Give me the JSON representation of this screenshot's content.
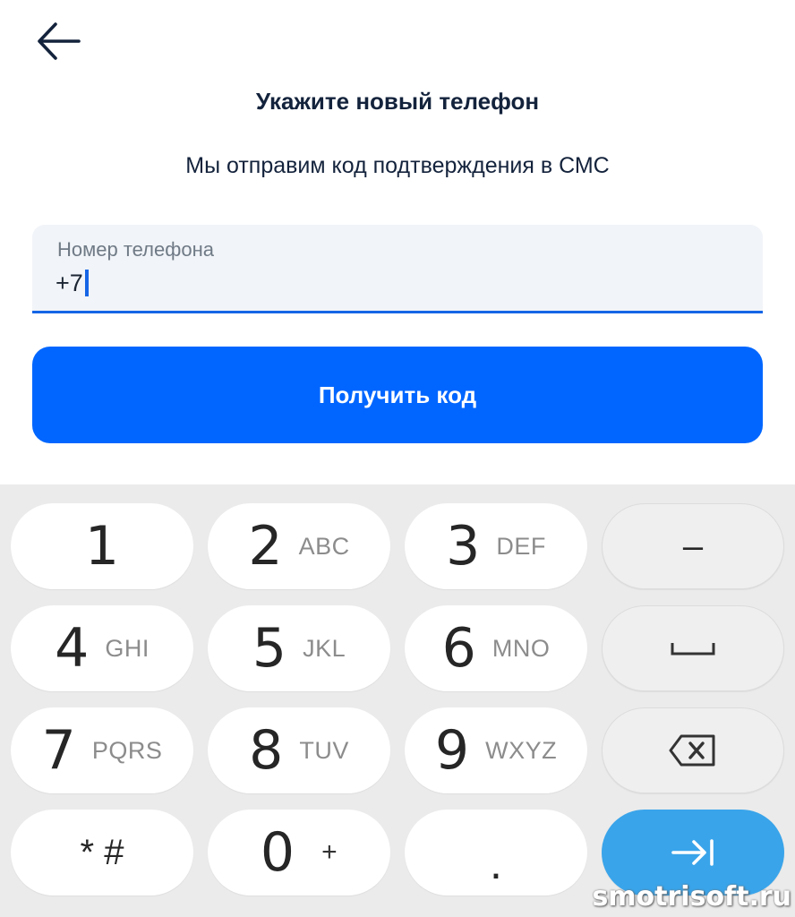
{
  "header": {
    "back_icon": "arrow-left-icon",
    "title": "Укажите новый телефон",
    "subtitle": "Мы отправим код подтверждения в СМС"
  },
  "phone_field": {
    "label": "Номер телефона",
    "value": "+7"
  },
  "submit_button": {
    "label": "Получить код"
  },
  "colors": {
    "accent": "#1565e6",
    "button": "#0066ff",
    "enter_key": "#39a4ea"
  },
  "keyboard": {
    "rows": [
      [
        {
          "digit": "1",
          "letters": ""
        },
        {
          "digit": "2",
          "letters": "ABC"
        },
        {
          "digit": "3",
          "letters": "DEF"
        },
        {
          "symbol": "–"
        }
      ],
      [
        {
          "digit": "4",
          "letters": "GHI"
        },
        {
          "digit": "5",
          "letters": "JKL"
        },
        {
          "digit": "6",
          "letters": "MNO"
        },
        {
          "icon": "space-icon"
        }
      ],
      [
        {
          "digit": "7",
          "letters": "PQRS"
        },
        {
          "digit": "8",
          "letters": "TUV"
        },
        {
          "digit": "9",
          "letters": "WXYZ"
        },
        {
          "icon": "backspace-icon"
        }
      ],
      [
        {
          "symbol": "* #"
        },
        {
          "digit": "0",
          "letters": "+"
        },
        {
          "symbol": "."
        },
        {
          "icon": "next-field-icon"
        }
      ]
    ]
  },
  "watermark": "smotrisoft.ru"
}
